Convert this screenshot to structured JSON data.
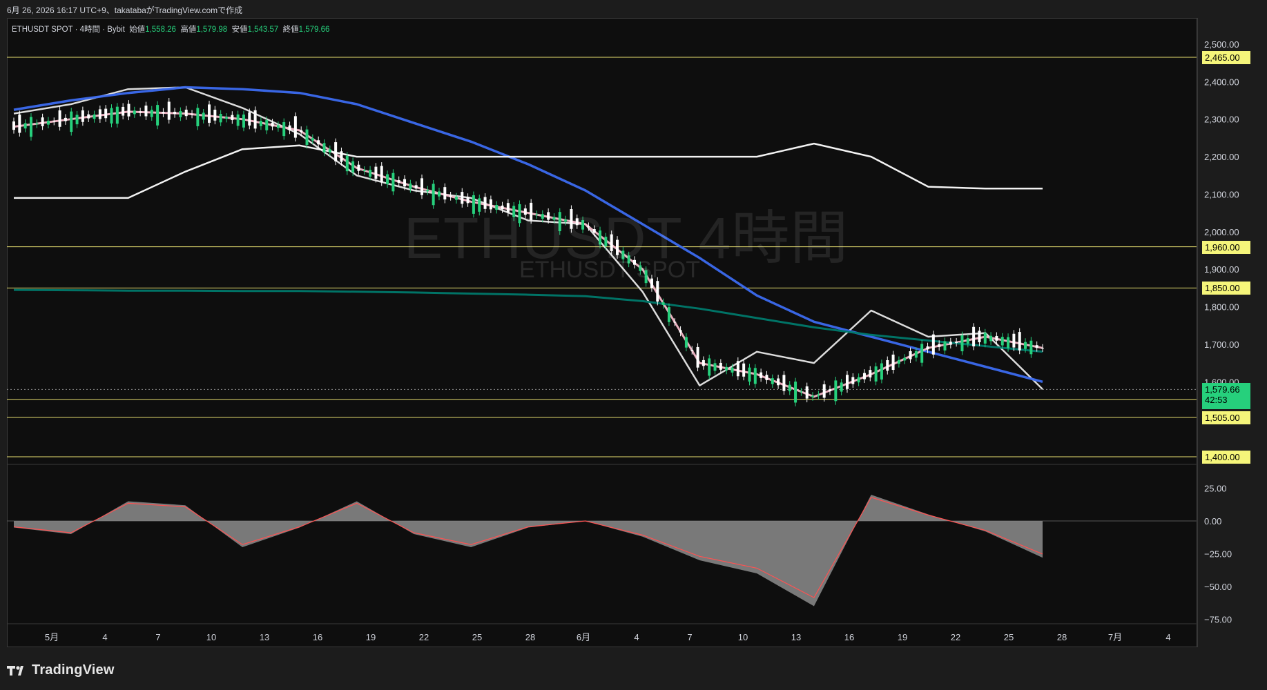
{
  "header": {
    "caption": "6月 26, 2026 16:17 UTC+9、takatabaがTradingView.comで作成"
  },
  "legend": {
    "symbol": "ETHUSDT SPOT · 4時間 · Bybit",
    "open_label": "始値",
    "open": "1,558.26",
    "high_label": "高値",
    "high": "1,579.98",
    "low_label": "安値",
    "low": "1,543.57",
    "close_label": "終値",
    "close": "1,579.66"
  },
  "watermark": {
    "title": "ETHUSDT 4時間",
    "subtitle": "ETHUSDT SPOT"
  },
  "price_axis": {
    "ticks": [
      "2,500.00",
      "2,400.00",
      "2,300.00",
      "2,200.00",
      "2,100.00",
      "2,000.00",
      "1,900.00",
      "1,800.00",
      "1,700.00",
      "1,600.00"
    ],
    "tick_values": [
      2500,
      2400,
      2300,
      2200,
      2100,
      2000,
      1900,
      1800,
      1700,
      1600
    ]
  },
  "levels": [
    {
      "label": "2,465.00",
      "value": 2465
    },
    {
      "label": "1,960.00",
      "value": 1960
    },
    {
      "label": "1,850.00",
      "value": 1850
    },
    {
      "label": "1,553.00",
      "value": 1553
    },
    {
      "label": "1,505.00",
      "value": 1505
    },
    {
      "label": "1,400.00",
      "value": 1400
    }
  ],
  "current_price": {
    "label": "1,579.66",
    "countdown": "42:53",
    "value": 1579.66
  },
  "oscillator_axis": {
    "ticks": [
      "25.00",
      "0.00",
      "−25.00",
      "−50.00",
      "−75.00"
    ],
    "tick_values": [
      25,
      0,
      -25,
      -50,
      -75
    ]
  },
  "time_axis": {
    "labels": [
      "5月",
      "4",
      "7",
      "10",
      "13",
      "16",
      "19",
      "22",
      "25",
      "28",
      "6月",
      "4",
      "7",
      "10",
      "13",
      "16",
      "19",
      "22",
      "25",
      "28",
      "7月",
      "4"
    ]
  },
  "chart_data": {
    "type": "line",
    "title": "ETHUSDT SPOT · 4時間 · Bybit",
    "x_label": "",
    "y_label": "",
    "ylim": [
      1400,
      2520
    ],
    "candle_colors": {
      "up": "#26d07c",
      "down": "#ffffff"
    },
    "x": [
      "5月",
      "4",
      "7",
      "10",
      "13",
      "16",
      "19",
      "22",
      "25",
      "28",
      "6月",
      "4",
      "7",
      "10",
      "13",
      "16",
      "19",
      "22",
      "25"
    ],
    "series": [
      {
        "color": "#e8e8e8",
        "values": [
          2315,
          2340,
          2380,
          2385,
          2330,
          2260,
          2150,
          2110,
          2090,
          2030,
          2020,
          1840,
          1590,
          1680,
          1650,
          1790,
          1720,
          1730,
          1580
        ]
      },
      {
        "color": "#3c6cf0",
        "values": [
          2325,
          2350,
          2370,
          2385,
          2380,
          2370,
          2340,
          2290,
          2240,
          2180,
          2110,
          2020,
          1930,
          1830,
          1760,
          1720,
          1680,
          1640,
          1600
        ]
      },
      {
        "color": "#f4b8c8",
        "values": [
          2280,
          2300,
          2320,
          2315,
          2300,
          2270,
          2170,
          2120,
          2080,
          2050,
          2020,
          1900,
          1650,
          1620,
          1560,
          1620,
          1690,
          1720,
          1690
        ]
      },
      {
        "color": "#00796b",
        "values": [
          1845,
          1844,
          1843,
          1843,
          1842,
          1842,
          1840,
          1838,
          1835,
          1832,
          1828,
          1815,
          1795,
          1770,
          1745,
          1725,
          1710,
          1695,
          1680
        ]
      },
      {
        "color": "#ffffff",
        "values": [
          2090,
          2090,
          2090,
          2160,
          2220,
          2230,
          2200,
          2200,
          2200,
          2200,
          2200,
          2200,
          2200,
          2200,
          2235,
          2200,
          2120,
          2115,
          2115
        ]
      }
    ],
    "oscillator": {
      "color": "#ff5252",
      "values": [
        -5,
        -10,
        15,
        12,
        -20,
        -5,
        15,
        -10,
        -20,
        -5,
        0,
        -12,
        -30,
        -40,
        -65,
        20,
        5,
        -8,
        -28
      ]
    }
  }
}
